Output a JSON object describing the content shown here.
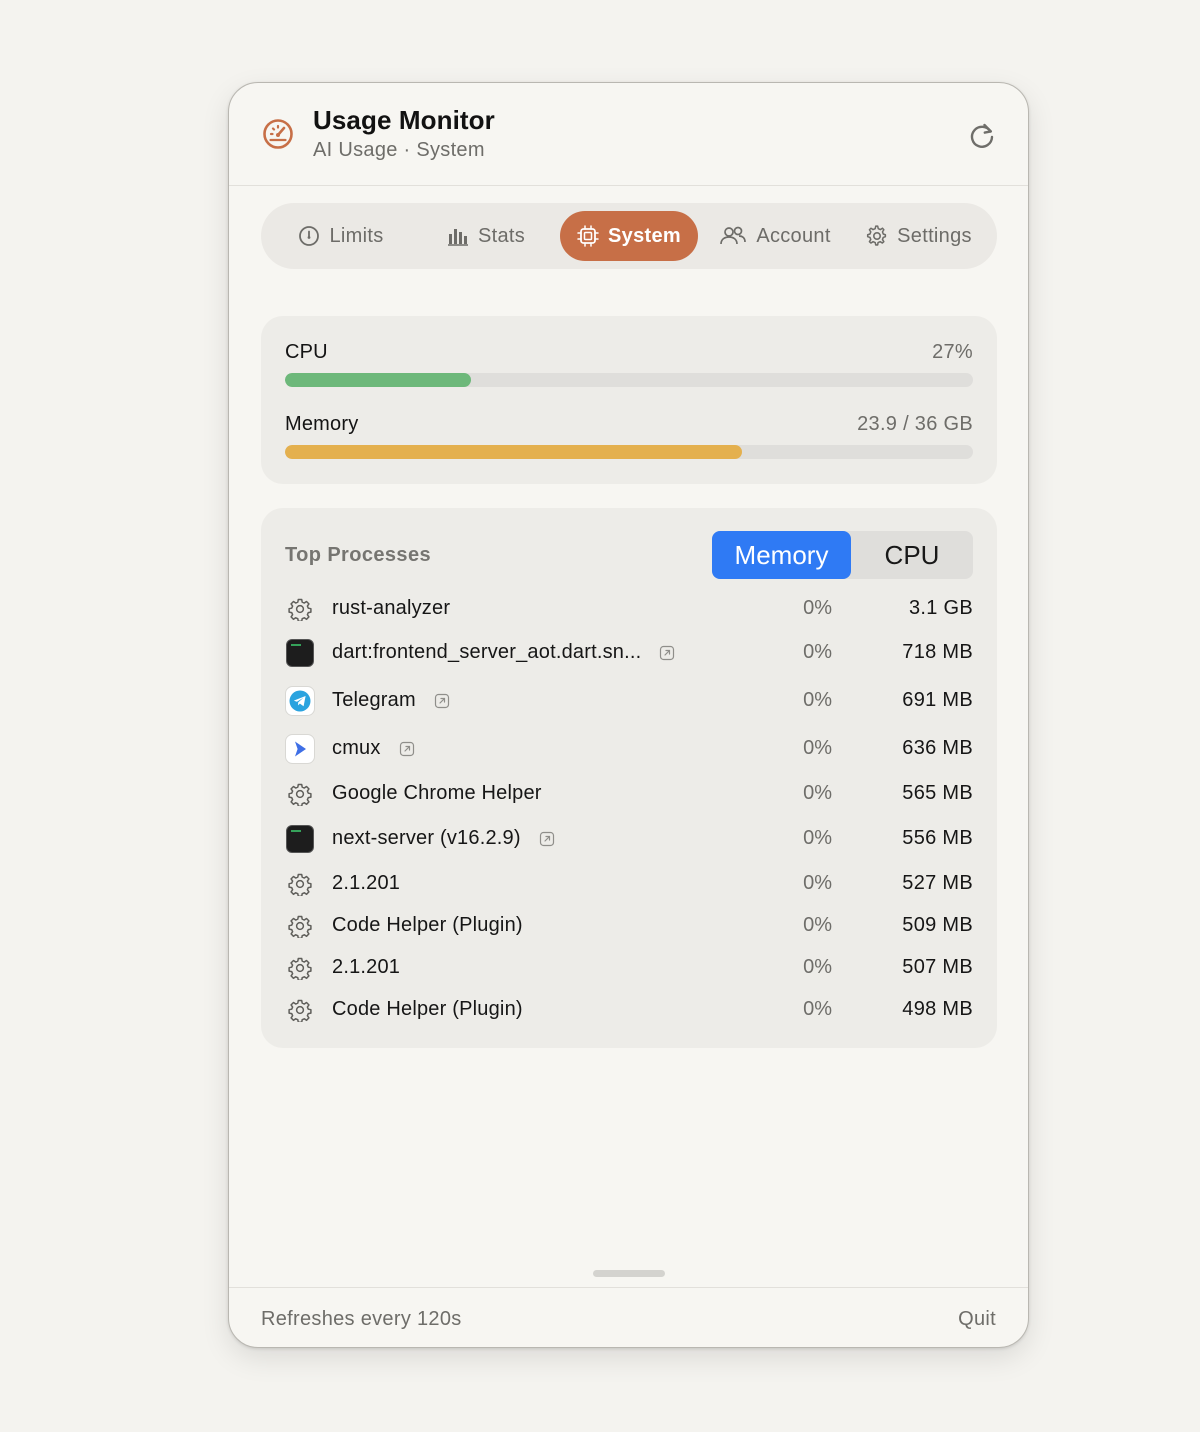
{
  "header": {
    "title": "Usage Monitor",
    "subtitle": "AI Usage · System",
    "icon": "gauge-icon",
    "refresh_icon": "refresh-icon"
  },
  "tabs": [
    {
      "label": "Limits",
      "icon": "gauge-icon",
      "active": false
    },
    {
      "label": "Stats",
      "icon": "bar-chart-icon",
      "active": false
    },
    {
      "label": "System",
      "icon": "cpu-chip-icon",
      "active": true
    },
    {
      "label": "Account",
      "icon": "people-icon",
      "active": false
    },
    {
      "label": "Settings",
      "icon": "gear-icon",
      "active": false
    }
  ],
  "resources": {
    "cpu": {
      "label": "CPU",
      "value": "27%",
      "fraction": 0.27,
      "color": "#6db87a"
    },
    "memory": {
      "label": "Memory",
      "value": "23.9 / 36 GB",
      "fraction": 0.664,
      "color": "#e4b04e"
    }
  },
  "processes": {
    "title": "Top Processes",
    "sort_options": {
      "memory": "Memory",
      "cpu": "CPU",
      "selected": "Memory"
    },
    "rows": [
      {
        "name": "rust-analyzer",
        "cpu": "0%",
        "mem": "3.1 GB",
        "icon": "gear-icon",
        "openable": false
      },
      {
        "name": "dart:frontend_server_aot.dart.sn...",
        "cpu": "0%",
        "mem": "718 MB",
        "icon": "terminal-icon",
        "openable": true
      },
      {
        "name": "Telegram",
        "cpu": "0%",
        "mem": "691 MB",
        "icon": "telegram-icon",
        "openable": true
      },
      {
        "name": "cmux",
        "cpu": "0%",
        "mem": "636 MB",
        "icon": "cmux-icon",
        "openable": true
      },
      {
        "name": "Google Chrome Helper",
        "cpu": "0%",
        "mem": "565 MB",
        "icon": "gear-icon",
        "openable": false
      },
      {
        "name": "next-server (v16.2.9)",
        "cpu": "0%",
        "mem": "556 MB",
        "icon": "terminal-icon",
        "openable": true
      },
      {
        "name": "2.1.201",
        "cpu": "0%",
        "mem": "527 MB",
        "icon": "gear-icon",
        "openable": false
      },
      {
        "name": "Code Helper (Plugin)",
        "cpu": "0%",
        "mem": "509 MB",
        "icon": "gear-icon",
        "openable": false
      },
      {
        "name": "2.1.201",
        "cpu": "0%",
        "mem": "507 MB",
        "icon": "gear-icon",
        "openable": false
      },
      {
        "name": "Code Helper (Plugin)",
        "cpu": "0%",
        "mem": "498 MB",
        "icon": "gear-icon",
        "openable": false
      }
    ]
  },
  "footer": {
    "refresh_text": "Refreshes every 120s",
    "quit_label": "Quit"
  },
  "colors": {
    "accent": "#c76f47",
    "segment_active": "#2f7af4"
  }
}
